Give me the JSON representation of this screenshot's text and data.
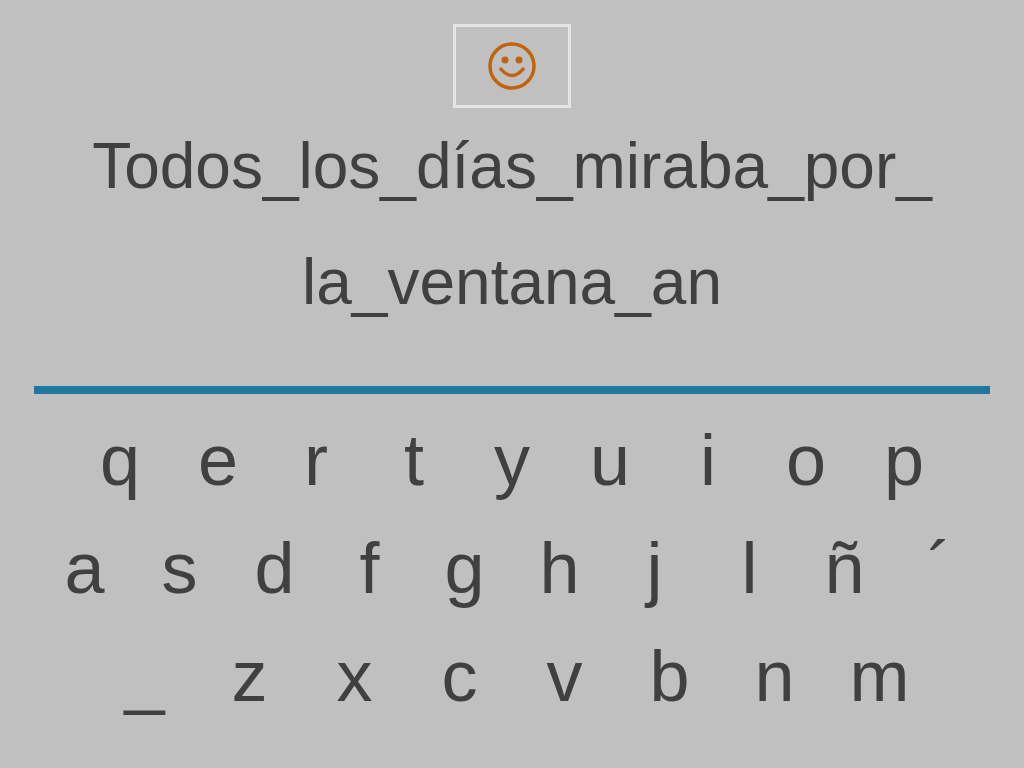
{
  "sentence_lines": [
    "Todos_los_días_miraba_por_",
    "la_ventana_an"
  ],
  "keyboard": [
    [
      "q",
      "e",
      "r",
      "t",
      "y",
      "u",
      "i",
      "o",
      "p"
    ],
    [
      "a",
      "s",
      "d",
      "f",
      "g",
      "h",
      "j",
      "l",
      "ñ",
      "´"
    ],
    [
      "_",
      "z",
      "x",
      "c",
      "v",
      "b",
      "n",
      "m"
    ]
  ]
}
